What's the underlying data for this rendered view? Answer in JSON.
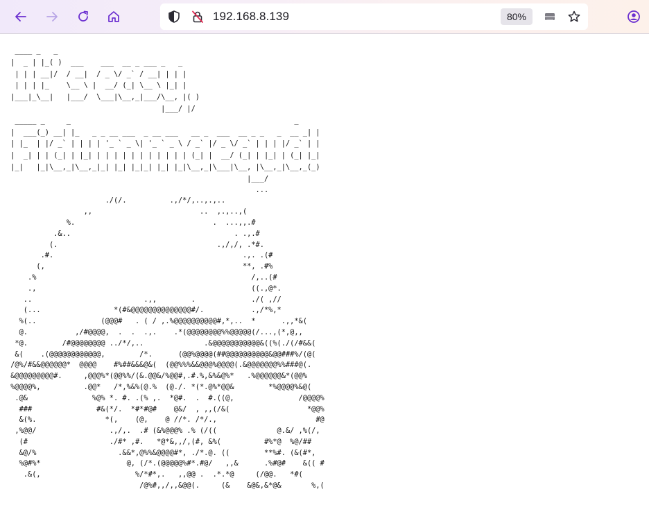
{
  "browser": {
    "url": "192.168.8.139",
    "zoom": "80%",
    "buttons": {
      "back": "back-arrow-icon",
      "forward": "forward-arrow-icon",
      "reload": "reload-icon",
      "home": "home-icon"
    }
  },
  "page": {
    "banner_art": "  ____ _   _   \n |  _ | |_( )  ___    ___  __ _ ___ _   _ \n  | | | __|/  / __|  / _ \\/ _` / __| | | |\n  | | | |_    \\__ \\ |  __/ (_| \\__ \\ |_| |\n |___|_\\__|   |___/  \\___|\\__,_|___/\\__, |( )\n                                    |___/ |/\n",
    "subtitle_art": "  _____ _     _                                                    _ \n |  ___(_) __| |_   _ _ __ ___  _ __ ___   __ _  ___  __ _ _   _  __ _| |\n | |_  | |/ _` | | | | '_ ` _ \\| '_ ` _ \\ / _` |/ _ \\/ _` | | | |/ _` | |\n |  _| | | (_| | |_| | | | | | | | | | | | (_| |  __/ (_| | |_| | (_| |_|\n |_|   |_|\\__,_|\\__,_|_| |_| |_|_| |_| |_|\\__,_|\\___|\\__, |\\__,_|\\__,_(_)\n                                                        |___/\n",
    "logo_art": "                                                          ...\n                       ./(/.          .,/*/,..,.,..\n                  ,,                         ..  ,.,..,(\n              %.                                .  ...,,.#\n           .&..                                      . .,.#\n          (.                                     .,/,/, .*#.\n        .#.                                            .,. .(#\n       (,                                              **, .#%\n     .%                                                  /,..(#\n     .,                                                  ((.,@*.\n    ..                          .,,        .             ./( ,//\n    (...                 *(#&@@@@@@@@@@@@@@#/.           .,/*%,*\n   %(..               (@@@#   . ( / ,.%@@@@@@@@@@#,*,..  *      .,,*&(\n   @.           ,/#@@@@,  .  .  .,.    .*(@@@@@@@@%%@@@@@(/...,(*,@,,\n  *@.        /#@@@@@@@@ ../*/,..              .&@@@@@@@@@@@&((%(./(/#&&(\n  &(    .(@@@@@@@@@@@@,        /*.      (@@%@@@@(##@@@@@@@@@@&@@###%/(@(\n /@%/#&&@@@@@@*  @@@@    #%##&&&@&(  (@@%%%&&@@@%@@@@(.&@@@@@@@%%###@(.\n &@@@@@@@@@#.     ,@@@%*(@@%%/(&.@@&/%@@#,.#.%,&%&@%*   .%@@@@@@&*(@@%\n %@@@@%,          .@@*   /*,%&%(@.%  (@./. *(*.@%*@@&        *%@@@@%&@(\n  .@&               %@% *. #. .(% ,.  *@#.  .  #.((@,               /@@@@%\n   ###               #&(*/.  *#*#@#    @&/  , ,,(/&(                  *@@%\n   &(%.                *(,    (@,    @ //*. /*/.,                       #@\n  ,%@@/                 .,/,.  .# (&%@@@% .% (/((              @.&/ ,%(/,\n   (#                   ./#* ,#.   *@*&,,/,(#, &%(          #%*@  %@/##\n   &@/%                   .&&*,@%%&@@@@#*, ./*.@. ((        **%#. (&(#*,\n   %@#%*                    @, (/*.(@@@@@%#*.#@/   ,,&      .%#@#    &(( #\n    .&(,                      %/*#*,.   ,,@@ .  .*.*@     (/@@.   *#(\n                               /@%#,,/,,&@@(.     (&    &@&,&*@&       %,(\n"
  }
}
